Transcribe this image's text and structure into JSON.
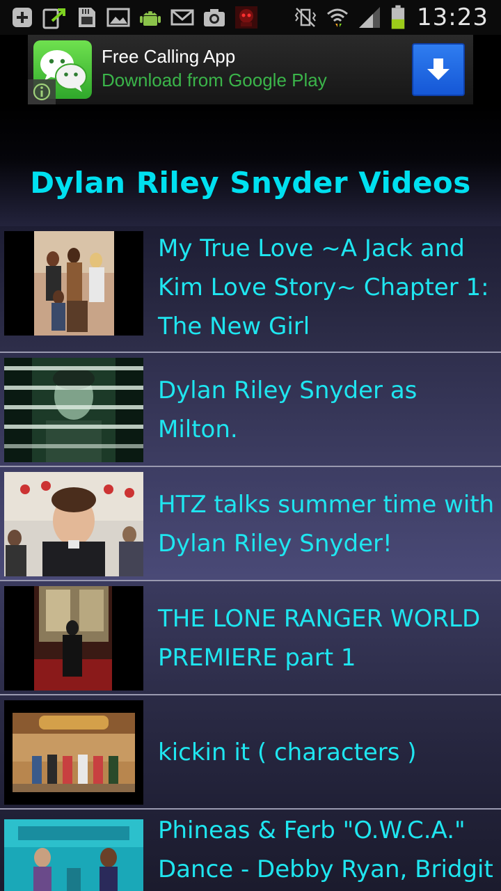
{
  "status_bar": {
    "time": "13:23",
    "icons": [
      "add-icon",
      "share-icon",
      "sd-card-icon",
      "image-icon",
      "android-icon",
      "mail-icon",
      "camera-icon",
      "robot-icon",
      "vibrate-icon",
      "wifi-icon",
      "signal-icon",
      "battery-icon"
    ]
  },
  "ad": {
    "title": "Free Calling App",
    "subtitle": "Download from Google Play",
    "app_icon": "wechat-app-icon",
    "download_icon": "download-arrow-icon",
    "info_icon": "info-icon",
    "colors": {
      "subtitle": "#3bb54a",
      "button": "#2f7df0"
    }
  },
  "header": {
    "title": "Dylan Riley Snyder Videos",
    "color": "#00e0f0"
  },
  "videos": [
    {
      "title": "My True Love ~A Jack and Kim Love Story~ Chapter 1: The New Girl"
    },
    {
      "title": "Dylan Riley Snyder as Milton."
    },
    {
      "title": "HTZ talks summer time with Dylan Riley Snyder!"
    },
    {
      "title": "THE LONE RANGER WORLD PREMIERE part 1"
    },
    {
      "title": "kickin it ( characters )"
    },
    {
      "title": "Phineas & Ferb \"O.W.C.A.\" Dance - Debby Ryan, Bridgit"
    }
  ],
  "list_text_color": "#1fe6f0"
}
